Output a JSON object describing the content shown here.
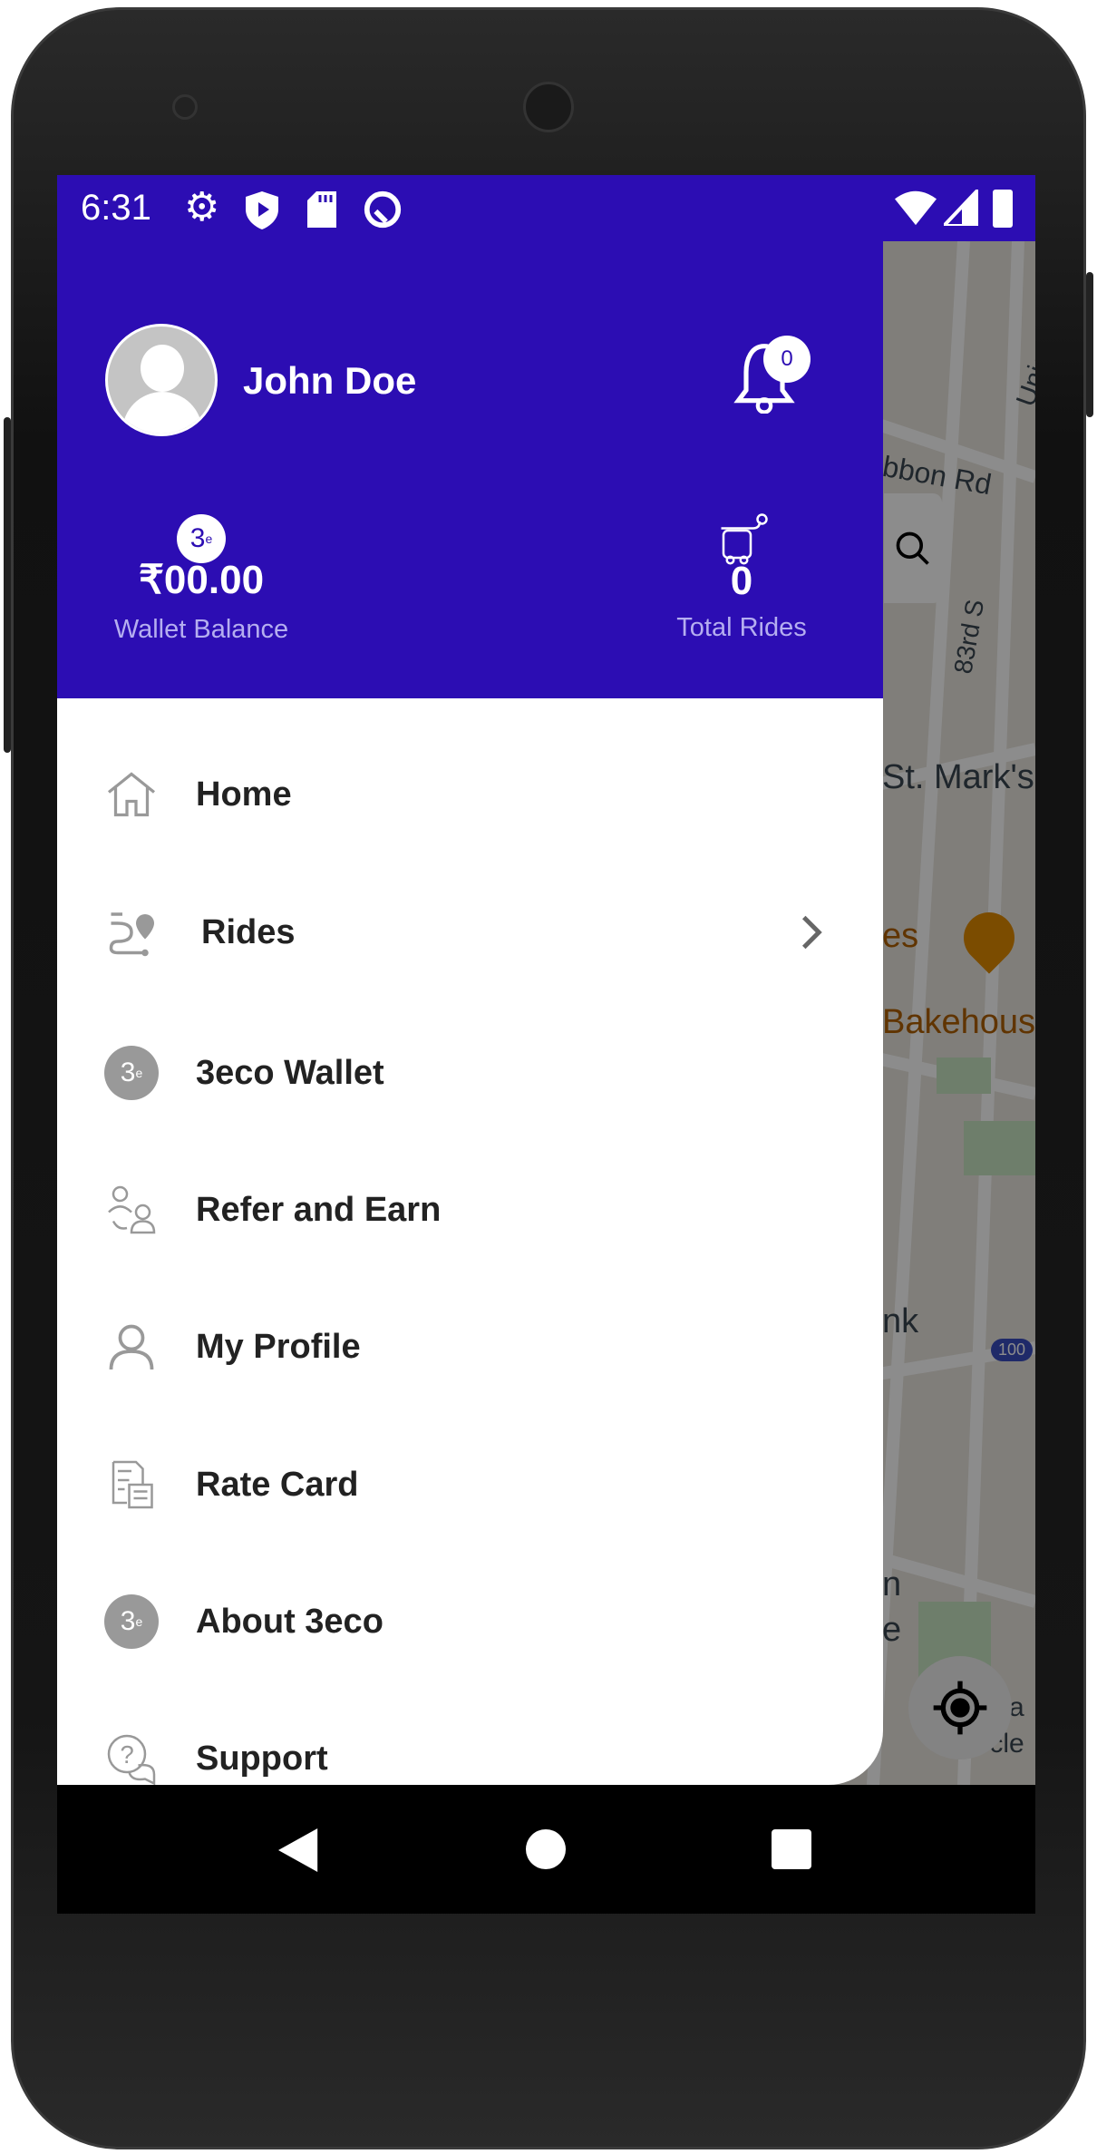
{
  "status_bar": {
    "time": "6:31",
    "icons": [
      "gear-icon",
      "shield-play-icon",
      "sd-card-icon",
      "sync-icon"
    ],
    "right_icons": [
      "wifi-icon",
      "signal-icon",
      "battery-icon"
    ]
  },
  "profile": {
    "name": "John Doe",
    "notification_count": "0"
  },
  "stats": {
    "wallet_amount": "₹00.00",
    "wallet_label": "Wallet Balance",
    "rides_count": "0",
    "rides_label": "Total Rides"
  },
  "menu": [
    {
      "label": "Home",
      "icon": "home-icon"
    },
    {
      "label": "Rides",
      "icon": "route-icon",
      "has_chevron": true
    },
    {
      "label": "3eco Wallet",
      "icon": "3eco-logo-icon"
    },
    {
      "label": "Refer and Earn",
      "icon": "refer-users-icon"
    },
    {
      "label": "My Profile",
      "icon": "user-icon"
    },
    {
      "label": "Rate Card",
      "icon": "rate-card-icon"
    },
    {
      "label": "About 3eco",
      "icon": "3eco-logo-icon"
    },
    {
      "label": "Support",
      "icon": "support-chat-icon"
    }
  ],
  "logo_text": "3eco",
  "map": {
    "labels": [
      "Union St",
      "bbon Rd",
      "83rd S",
      "St. Mark's",
      "es",
      "Bakehous",
      "nk",
      "100",
      "n",
      "e",
      "appa",
      "Circle"
    ]
  },
  "colors": {
    "primary": "#2c0db3",
    "icon_gray": "#999999"
  }
}
